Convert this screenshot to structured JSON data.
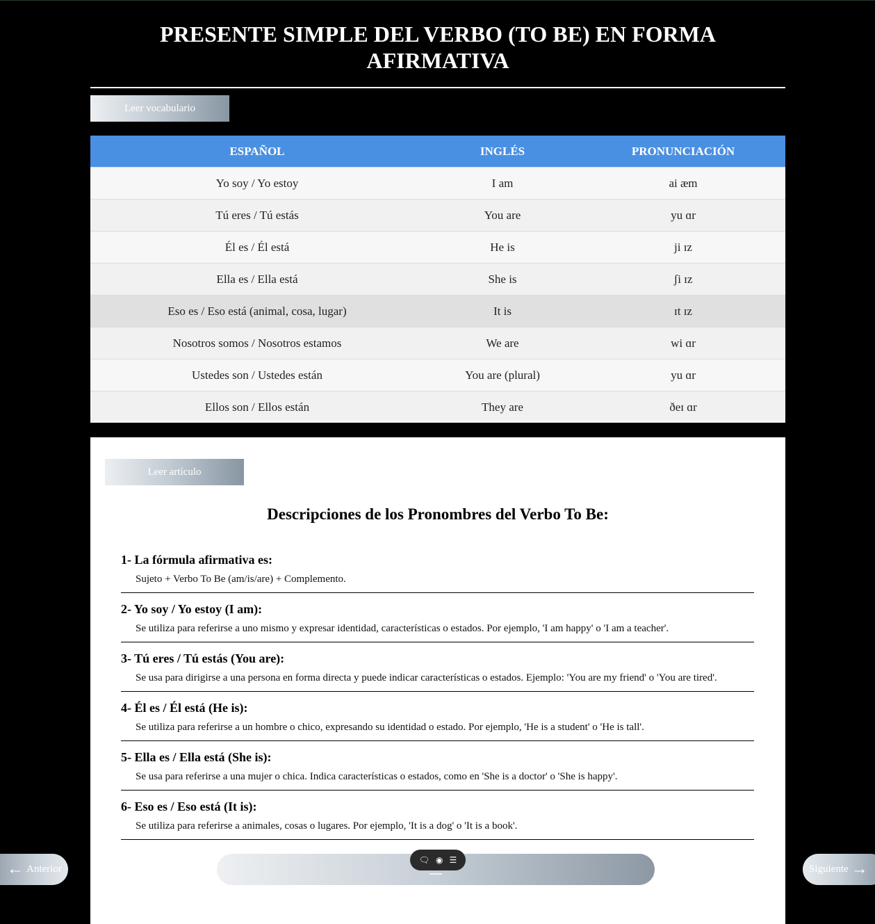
{
  "page": {
    "title": "PRESENTE SIMPLE DEL VERBO (TO BE) EN FORMA AFIRMATIVA",
    "read_vocab_label": "Leer vocabulario",
    "read_article_label": "Leer artículo"
  },
  "vocab": {
    "headers": [
      "ESPAÑOL",
      "INGLÉS",
      "PRONUNCIACIÓN"
    ],
    "rows": [
      [
        "Yo soy / Yo estoy",
        "I am",
        "ai æm"
      ],
      [
        "Tú eres / Tú estás",
        "You are",
        "yu ɑr"
      ],
      [
        "Él es / Él está",
        "He is",
        "ji ɪz"
      ],
      [
        "Ella es / Ella está",
        "She is",
        "ʃi ɪz"
      ],
      [
        "Eso es / Eso está (animal, cosa, lugar)",
        "It is",
        "ɪt ɪz"
      ],
      [
        "Nosotros somos / Nosotros estamos",
        "We are",
        "wi ɑr"
      ],
      [
        "Ustedes son / Ustedes están",
        "You are (plural)",
        "yu ɑr"
      ],
      [
        "Ellos son / Ellos están",
        "They are",
        "ðeɪ ɑr"
      ]
    ]
  },
  "article": {
    "title": "Descripciones de los Pronombres del Verbo To Be:",
    "items": [
      {
        "heading": "1- La fórmula afirmativa es:",
        "text": "Sujeto + Verbo To Be (am/is/are) + Complemento."
      },
      {
        "heading": "2- Yo soy / Yo estoy (I am):",
        "text": "Se utiliza para referirse a uno mismo y expresar identidad, características o estados. Por ejemplo, 'I am happy' o 'I am a teacher'."
      },
      {
        "heading": "3- Tú eres / Tú estás (You are):",
        "text": "Se usa para dirigirse a una persona en forma directa y puede indicar características o estados. Ejemplo: 'You are my friend' o 'You are tired'."
      },
      {
        "heading": "4- Él es / Él está (He is):",
        "text": "Se utiliza para referirse a un hombre o chico, expresando su identidad o estado. Por ejemplo, 'He is a student' o 'He is tall'."
      },
      {
        "heading": "5- Ella es / Ella está (She is):",
        "text": "Se usa para referirse a una mujer o chica. Indica características o estados, como en 'She is a doctor' o 'She is happy'."
      },
      {
        "heading": "6- Eso es / Eso está (It is):",
        "text": "Se utiliza para referirse a animales, cosas o lugares. Por ejemplo, 'It is a dog' o 'It is a book'."
      }
    ]
  },
  "nav": {
    "prev_label": "Anterior",
    "next_label": "Siguiente",
    "prev_icon": "arrow-left-icon",
    "next_icon": "arrow-right-icon",
    "tools": [
      "comment-icon",
      "eye-icon",
      "list-icon"
    ]
  }
}
